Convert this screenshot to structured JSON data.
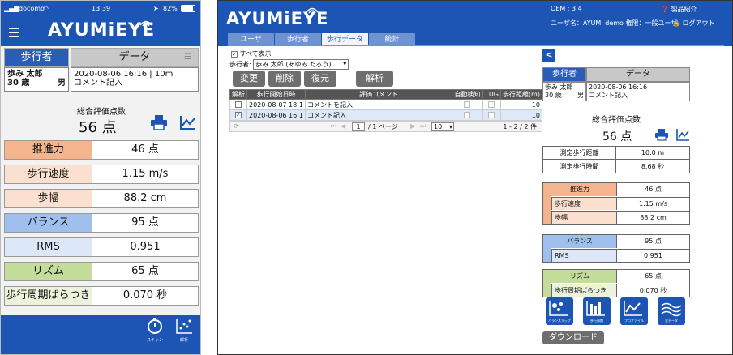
{
  "phone": {
    "status": {
      "carrier": "docomo",
      "time": "13:39",
      "battery": "82%"
    },
    "logo": "AYUMiEYE",
    "tabs": {
      "walker": "歩行者",
      "data": "データ"
    },
    "walker": {
      "name": "歩み 太郎",
      "age": "30 歳",
      "sex": "男"
    },
    "data_info": {
      "datetime": "2020-08-06 16:16 | 10m",
      "comment": "コメント記入"
    },
    "score_label": "総合評価点数",
    "score": "56 点",
    "rows": [
      {
        "label": "推進力",
        "value": "46 点",
        "color": "#f4b58e"
      },
      {
        "label": "歩行速度",
        "value": "1.15 m/s",
        "color": "#fbe0d0"
      },
      {
        "label": "歩幅",
        "value": "88.2 cm",
        "color": "#fbe0d0"
      },
      {
        "label": "バランス",
        "value": "95 点",
        "color": "#9fc0ee"
      },
      {
        "label": "RMS",
        "value": "0.951",
        "color": "#dce8f7"
      },
      {
        "label": "リズム",
        "value": "65 点",
        "color": "#c3dc9a"
      },
      {
        "label": "歩行周期ばらつき",
        "value": "0.070 秒",
        "color": "#ebf3dc"
      }
    ],
    "footer": {
      "scan": "スキャン",
      "analysis": "解析"
    }
  },
  "web": {
    "oem": "OEM : 3.4",
    "product_info": "製品紹介",
    "user_line": "ユーザ名：AYUMI demo 権限：一般ユーザ",
    "logout": "ログアウト",
    "logo": "AYUMiEYE",
    "tabs": [
      "ユーザ",
      "歩行者",
      "歩行データ",
      "統計"
    ],
    "show_all": "すべて表示",
    "walker_label": "歩行者:",
    "walker_select": "歩み 太郎 (あゆみ たろう)",
    "buttons": [
      "変更",
      "削除",
      "復元",
      "解析"
    ],
    "table": {
      "headers": [
        "解析",
        "歩行開始日時",
        "評価コメント",
        "自動検知",
        "TUG",
        "歩行距離(m)"
      ],
      "rows": [
        {
          "checked": false,
          "datetime": "2020-08-07 18:1",
          "comment": "コメントを記入",
          "distance": "10"
        },
        {
          "checked": true,
          "datetime": "2020-08-06 16:1",
          "comment": "コメント記入",
          "distance": "10"
        }
      ]
    },
    "pager": {
      "page": "1",
      "of_pages": "/ 1 ページ",
      "per_page": "10",
      "count": "1 - 2 / 2 件"
    },
    "back": "<",
    "panel": {
      "tabs": {
        "walker": "歩行者",
        "data": "データ"
      },
      "walker": {
        "name": "歩み 太郎",
        "age": "30 歳",
        "sex": "男"
      },
      "data_info": {
        "datetime": "2020-08-06 16:16",
        "comment": "コメント記入"
      },
      "score_label": "総合評価点数",
      "score": "56 点",
      "measure": [
        {
          "label": "測定歩行距離",
          "value": "10.0 m"
        },
        {
          "label": "測定歩行時間",
          "value": "8.68 秒"
        }
      ],
      "groups": [
        {
          "label": "推進力",
          "value": "46 点",
          "color": "#f4b58e",
          "subcolor": "#fbe0d0",
          "subs": [
            {
              "label": "歩行速度",
              "value": "1.15 m/s"
            },
            {
              "label": "歩幅",
              "value": "88.2 cm"
            }
          ]
        },
        {
          "label": "バランス",
          "value": "95 点",
          "color": "#9fc0ee",
          "subcolor": "#dce8f7",
          "subs": [
            {
              "label": "RMS",
              "value": "0.951"
            }
          ]
        },
        {
          "label": "リズム",
          "value": "65 点",
          "color": "#c3dc9a",
          "subcolor": "#ebf3dc",
          "subs": [
            {
              "label": "歩行周期ばらつき",
              "value": "0.070 秒"
            }
          ]
        }
      ],
      "icon_buttons": [
        "バランスマップ",
        "歩行周期",
        "プロファイル",
        "全データ"
      ],
      "download": "ダウンロード"
    }
  }
}
